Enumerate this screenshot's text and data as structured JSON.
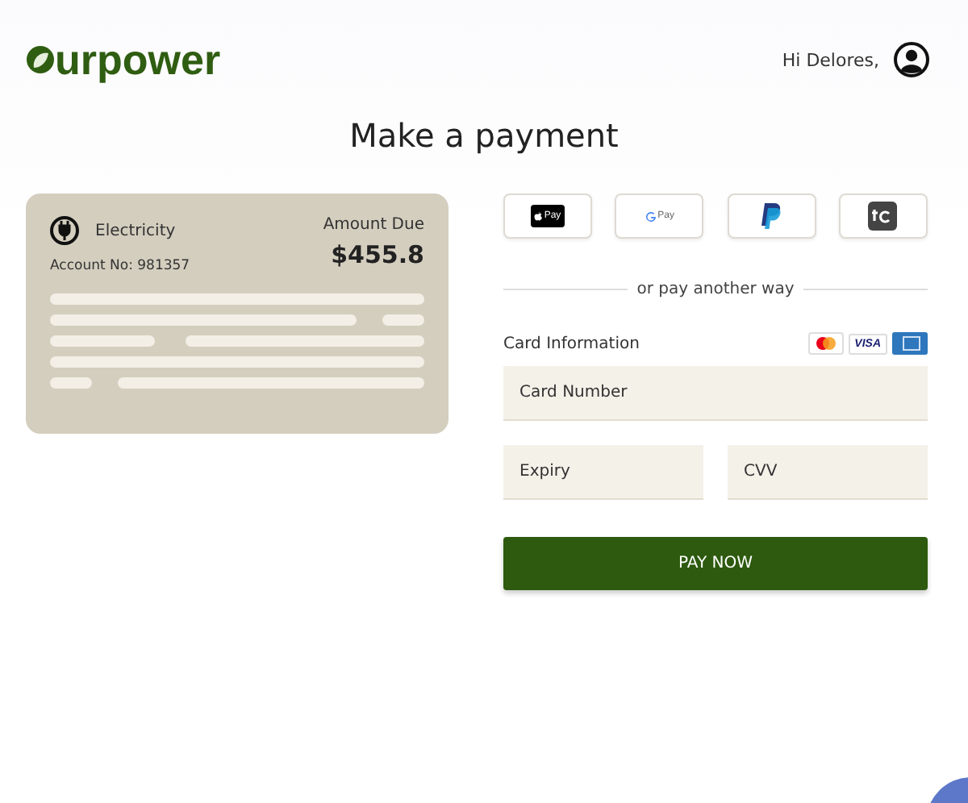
{
  "header": {
    "logo": "urpower",
    "greeting": "Hi Delores,"
  },
  "title": "Make a payment",
  "bill": {
    "service": "Electricity",
    "account": "Account No: 981357",
    "amount_label": "Amount Due",
    "amount": "$455.8"
  },
  "wallets": [
    {
      "kind": "applepay",
      "label": "Pay"
    },
    {
      "kind": "googlepay",
      "label": "Pay"
    },
    {
      "kind": "paypal"
    },
    {
      "kind": "tc"
    }
  ],
  "divider": "or pay another way",
  "card_info": {
    "label": "Card Information",
    "brands": [
      {
        "kind": "mastercard"
      },
      {
        "kind": "visa",
        "label": "VISA"
      },
      {
        "kind": "amex"
      }
    ]
  },
  "fields": [
    {
      "placeholder": "Card Number",
      "kind": "full"
    },
    {
      "placeholder": "Expiry",
      "kind": "half"
    },
    {
      "placeholder": "CVV",
      "kind": "half"
    }
  ],
  "submit": "PAY NOW"
}
